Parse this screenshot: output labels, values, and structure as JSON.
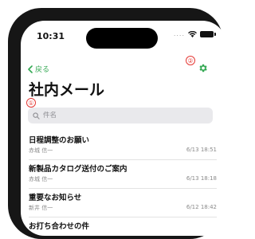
{
  "status_bar": {
    "time": "10:31",
    "signal": "....",
    "wifi_icon": "wifi-icon",
    "battery_icon": "battery-icon"
  },
  "nav": {
    "back_label": "戻る",
    "back_icon": "chevron-left-icon",
    "settings_icon": "gear-icon"
  },
  "annotations": {
    "marker_1": "①",
    "marker_2": "②",
    "color": "#e53935"
  },
  "page_title": "社内メール",
  "search": {
    "placeholder": "件名",
    "value": "",
    "icon": "search-icon"
  },
  "accent_color": "#34a853",
  "mails": [
    {
      "subject": "日程調整のお願い",
      "sender": "赤城 信一",
      "date": "6/13 18:51"
    },
    {
      "subject": "新製品カタログ送付のご案内",
      "sender": "赤城 信一",
      "date": "6/13 18:18"
    },
    {
      "subject": "重要なお知らせ",
      "sender": "新井 信一",
      "date": "6/12 18:42"
    },
    {
      "subject": "お打ち合わせの件",
      "sender": "",
      "date": ""
    }
  ]
}
